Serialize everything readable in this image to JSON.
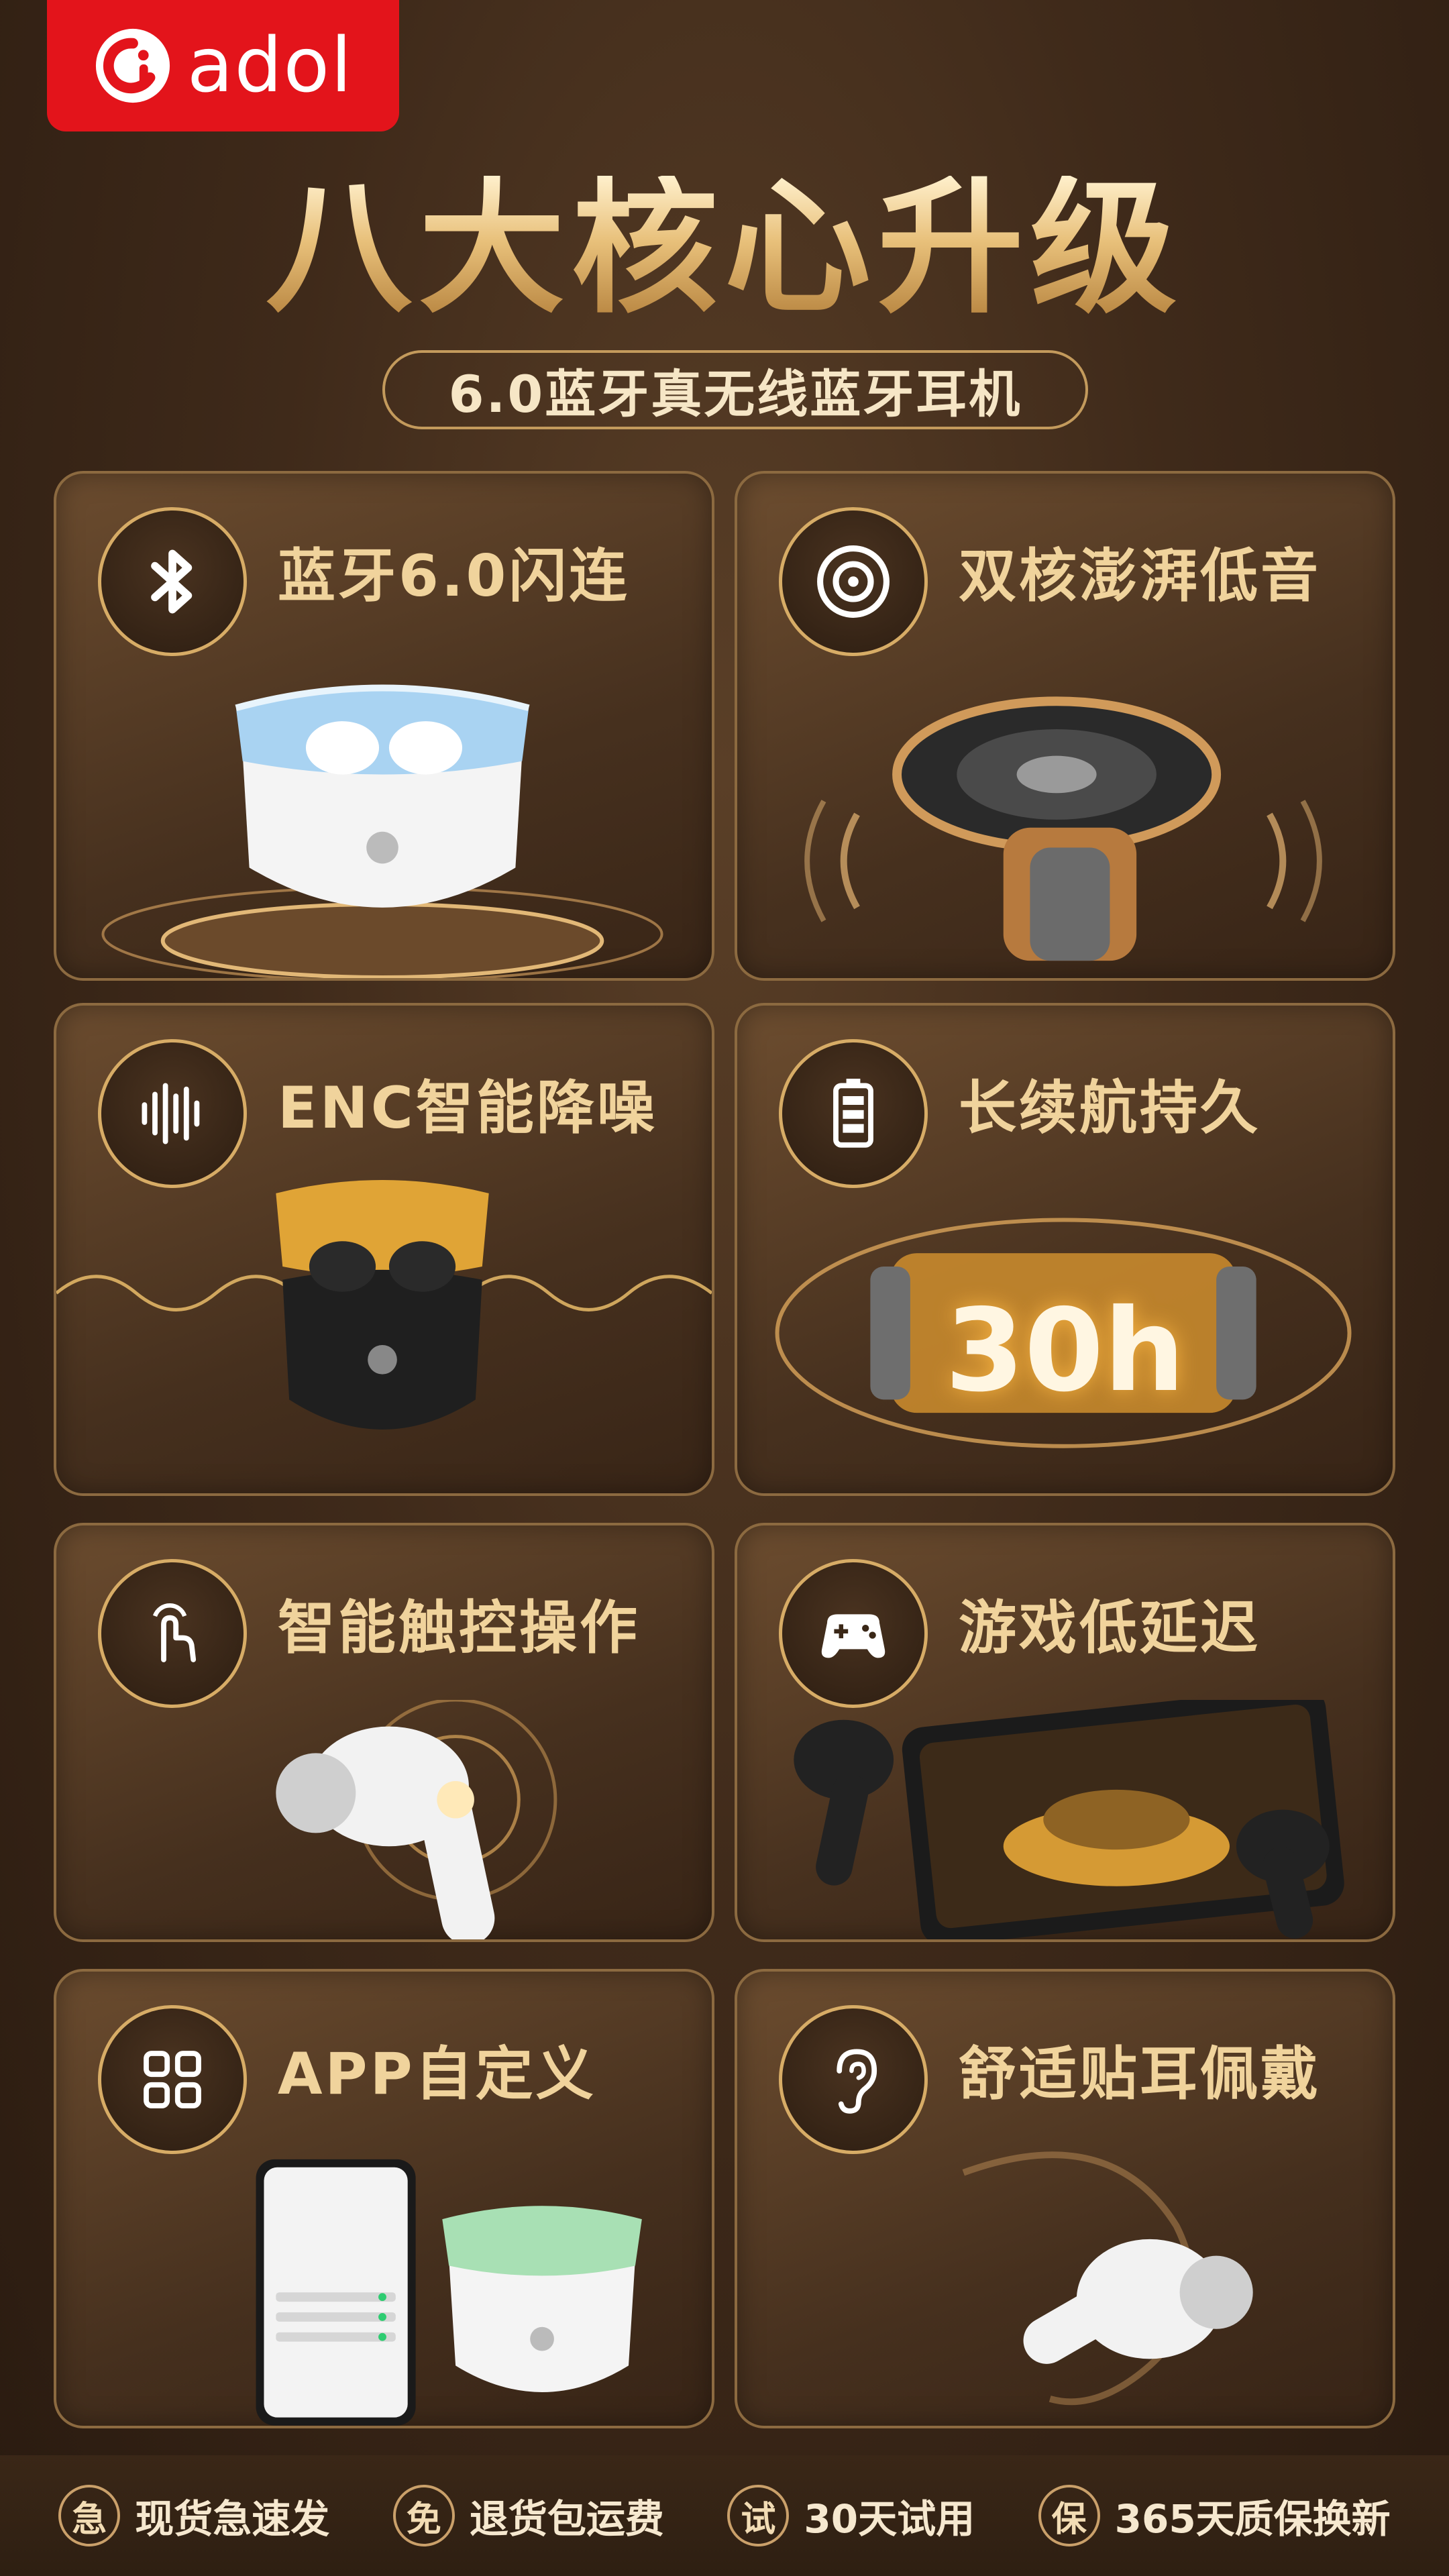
{
  "brand": {
    "name": "adol",
    "colors": {
      "logo_bg": "#e3141b",
      "gold": "#d7ac66",
      "bg": "#3f2a1a"
    }
  },
  "header": {
    "title": "八大核心升级",
    "subtitle": "6.0蓝牙真无线蓝牙耳机"
  },
  "features": [
    {
      "title": "蓝牙6.0闪连",
      "icon": "bluetooth-icon"
    },
    {
      "title": "双核澎湃低音",
      "icon": "speaker-icon"
    },
    {
      "title": "ENC智能降噪",
      "icon": "sound-wave-icon"
    },
    {
      "title": "长续航持久",
      "icon": "battery-icon",
      "badge": "30h"
    },
    {
      "title": "智能触控操作",
      "icon": "touch-hand-icon"
    },
    {
      "title": "游戏低延迟",
      "icon": "gamepad-icon"
    },
    {
      "title": "APP自定义",
      "icon": "app-grid-icon"
    },
    {
      "title": "舒适贴耳佩戴",
      "icon": "ear-icon"
    }
  ],
  "footer": [
    {
      "badge": "急",
      "label": "现货急速发"
    },
    {
      "badge": "免",
      "label": "退货包运费"
    },
    {
      "badge": "试",
      "label": "30天试用"
    },
    {
      "badge": "保",
      "label": "365天质保换新"
    }
  ]
}
